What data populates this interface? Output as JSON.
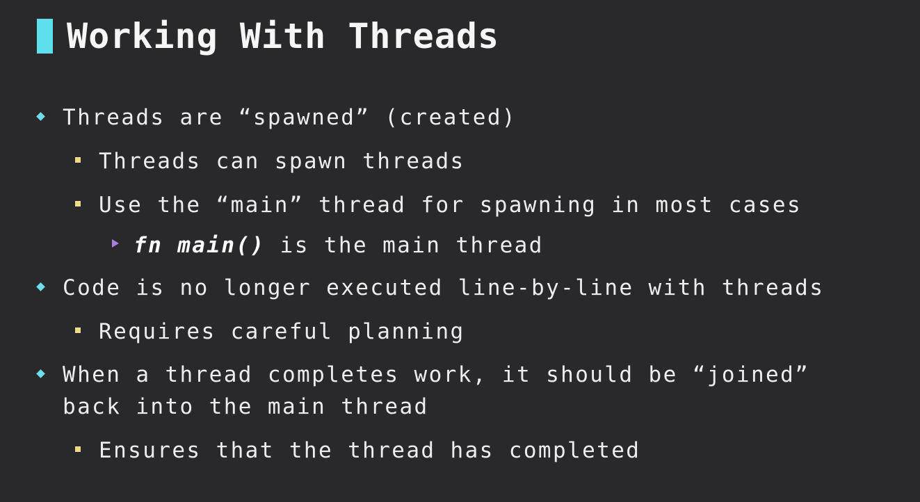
{
  "slide": {
    "title": "Working With Threads",
    "colors": {
      "background": "#29282b",
      "title_accent": "#5ee0ec",
      "level1_bullet": "#6fdcea",
      "level2_bullet": "#ecd98c",
      "level3_bullet": "#a97fdc"
    },
    "bullets": [
      {
        "text": "Threads are “spawned” (created)"
      },
      {
        "text": "Threads can spawn threads"
      },
      {
        "text": "Use the “main” thread for spawning in most cases"
      },
      {
        "code": "fn main()",
        "text": " is the main thread"
      },
      {
        "text": "Code is no longer executed line-by-line with threads"
      },
      {
        "text": "Requires careful planning"
      },
      {
        "text": "When a thread completes work, it should be “joined”",
        "continuation": "back into the main thread"
      },
      {
        "text": "Ensures that the thread has completed"
      }
    ]
  }
}
